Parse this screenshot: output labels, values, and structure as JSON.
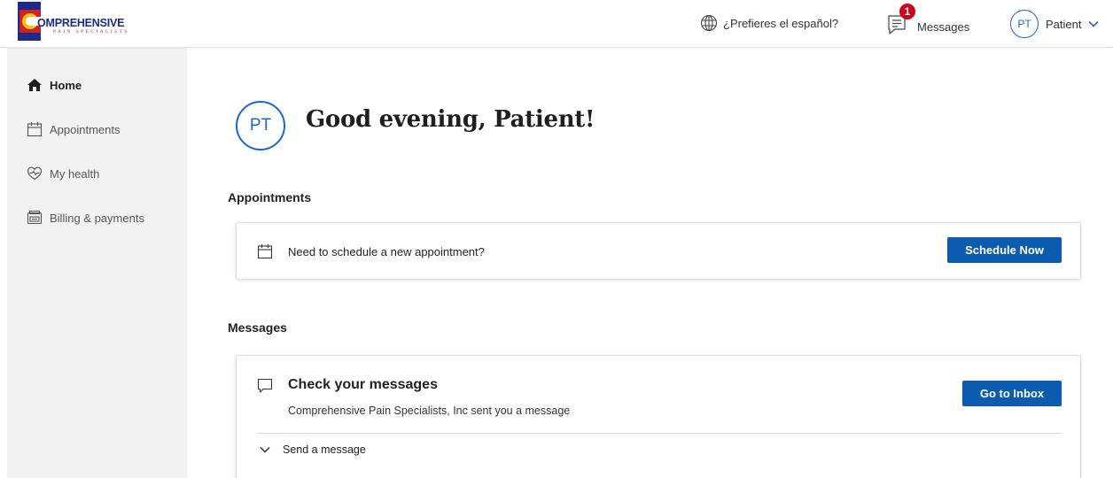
{
  "colors": {
    "accent": "#1967d2",
    "button": "#0b5cb0",
    "badge": "#d0021b",
    "sidebar_bg": "#f2f2f2"
  },
  "header": {
    "logo_text": "OMPREHENSIVE",
    "logo_subtext": "PAIN SPECIALISTS",
    "language_link": "¿Prefieres el español?",
    "messages_label": "Messages",
    "messages_badge": "1",
    "user_initials": "PT",
    "user_name": "Patient"
  },
  "sidebar": {
    "items": [
      {
        "label": "Home",
        "icon": "home-icon",
        "active": true
      },
      {
        "label": "Appointments",
        "icon": "calendar-icon",
        "active": false
      },
      {
        "label": "My health",
        "icon": "heart-pulse-icon",
        "active": false
      },
      {
        "label": "Billing & payments",
        "icon": "billing-icon",
        "active": false
      }
    ]
  },
  "main": {
    "avatar_initials": "PT",
    "greeting": "Good evening, Patient!",
    "appointments": {
      "section_title": "Appointments",
      "prompt": "Need to schedule a new appointment?",
      "button": "Schedule Now"
    },
    "messages": {
      "section_title": "Messages",
      "title": "Check your messages",
      "subtitle": "Comprehensive Pain Specialists, Inc sent you a message",
      "button": "Go to Inbox",
      "send_label": "Send a message"
    }
  }
}
